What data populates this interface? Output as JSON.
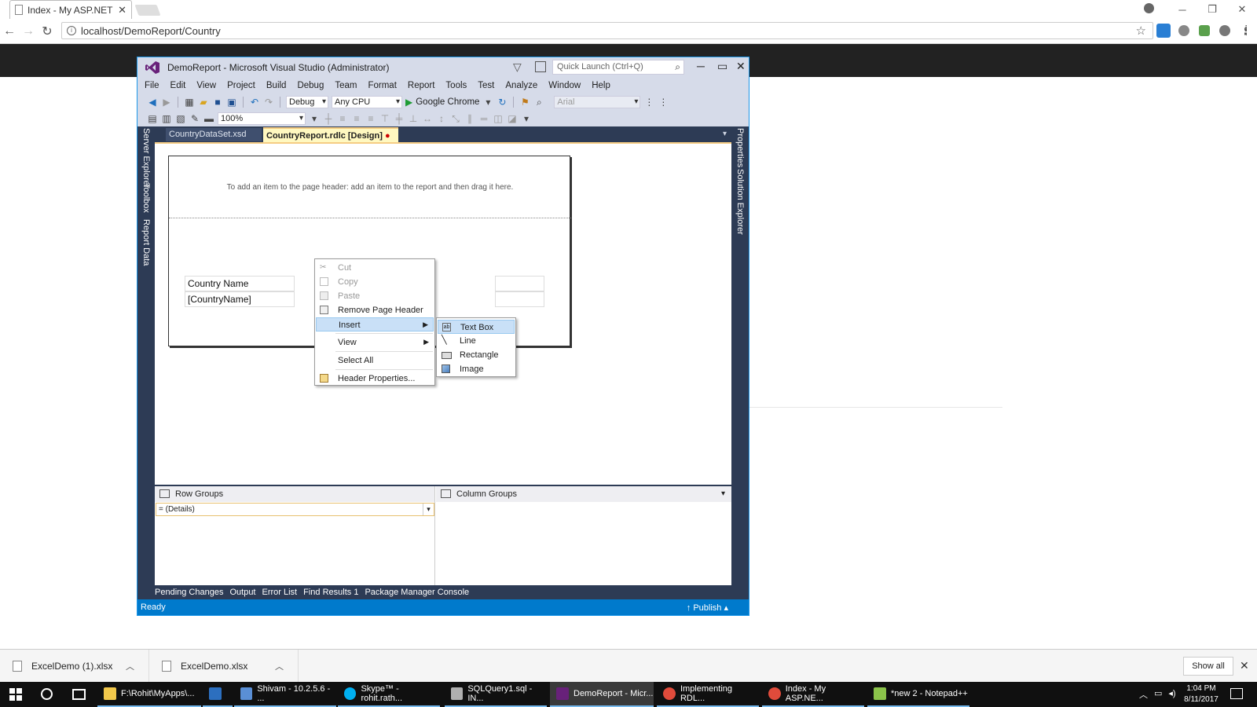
{
  "browser": {
    "tab_title": "Index - My ASP.NET App",
    "tab_close": "✕",
    "url": "localhost/DemoReport/Country",
    "controls": {
      "minimize": "─",
      "restore": "❐",
      "close": "✕"
    }
  },
  "vs": {
    "title": "DemoReport - Microsoft Visual Studio (Administrator)",
    "quick_launch_placeholder": "Quick Launch (Ctrl+Q)",
    "menu": [
      "File",
      "Edit",
      "View",
      "Project",
      "Build",
      "Debug",
      "Team",
      "Format",
      "Report",
      "Tools",
      "Test",
      "Analyze",
      "Window",
      "Help"
    ],
    "toolbar": {
      "config": "Debug",
      "platform": "Any CPU",
      "run_target": "Google Chrome",
      "font": "Arial",
      "zoom": "100%"
    },
    "side_tabs_left": [
      "Server Explorer",
      "Toolbox",
      "Report Data"
    ],
    "side_tabs_right": [
      "Properties",
      "Solution Explorer"
    ],
    "doc_tabs": {
      "inactive": "CountryDataSet.xsd",
      "active": "CountryReport.rdlc [Design]"
    },
    "report": {
      "header_hint": "To add an item to the page header: add an item to the report and then drag it here.",
      "table_header": "Country Name",
      "table_field": "[CountryName]"
    },
    "context_menu": {
      "items": [
        {
          "label": "Cut",
          "icon": "cut-icon",
          "disabled": true
        },
        {
          "label": "Copy",
          "icon": "copy-icon",
          "disabled": true
        },
        {
          "label": "Paste",
          "icon": "paste-icon",
          "disabled": true
        },
        {
          "label": "Remove Page Header",
          "icon": "remove-header-icon",
          "disabled": false
        },
        {
          "label": "Insert",
          "icon": "",
          "disabled": false
        },
        {
          "label": "View",
          "icon": "",
          "disabled": false
        },
        {
          "label": "Select All",
          "icon": "",
          "disabled": false
        },
        {
          "label": "Header Properties...",
          "icon": "properties-icon",
          "disabled": false
        }
      ],
      "submenu": [
        {
          "label": "Text Box",
          "icon": "textbox-icon"
        },
        {
          "label": "Line",
          "icon": "line-icon"
        },
        {
          "label": "Rectangle",
          "icon": "rectangle-icon"
        },
        {
          "label": "Image",
          "icon": "image-icon"
        }
      ]
    },
    "grouping": {
      "row_groups": "Row Groups",
      "column_groups": "Column Groups",
      "details": "= (Details)"
    },
    "tool_tabs": [
      "Pending Changes",
      "Output",
      "Error List",
      "Find Results 1",
      "Package Manager Console"
    ],
    "status": "Ready",
    "publish": "Publish"
  },
  "downloads": {
    "items": [
      "ExcelDemo (1).xlsx",
      "ExcelDemo.xlsx"
    ],
    "show_all": "Show all"
  },
  "taskbar": {
    "apps": [
      {
        "label": "F:\\Rohit\\MyApps\\...",
        "color": "#f2c84b"
      },
      {
        "label": "",
        "color": "#2c6fbf"
      },
      {
        "label": "Shivam - 10.2.5.6 - ...",
        "color": "#5a8fd6"
      },
      {
        "label": "Skype™ - rohit.rath...",
        "color": "#00aff0"
      },
      {
        "label": "SQLQuery1.sql - IN...",
        "color": "#b0b0b0"
      },
      {
        "label": "DemoReport - Micr...",
        "color": "#68217a"
      },
      {
        "label": "Implementing RDL...",
        "color": "#e04b3b"
      },
      {
        "label": "Index - My ASP.NE...",
        "color": "#e04b3b"
      },
      {
        "label": "*new 2 - Notepad++",
        "color": "#8bc34a"
      }
    ],
    "time": "1:04 PM",
    "date": "8/11/2017"
  }
}
